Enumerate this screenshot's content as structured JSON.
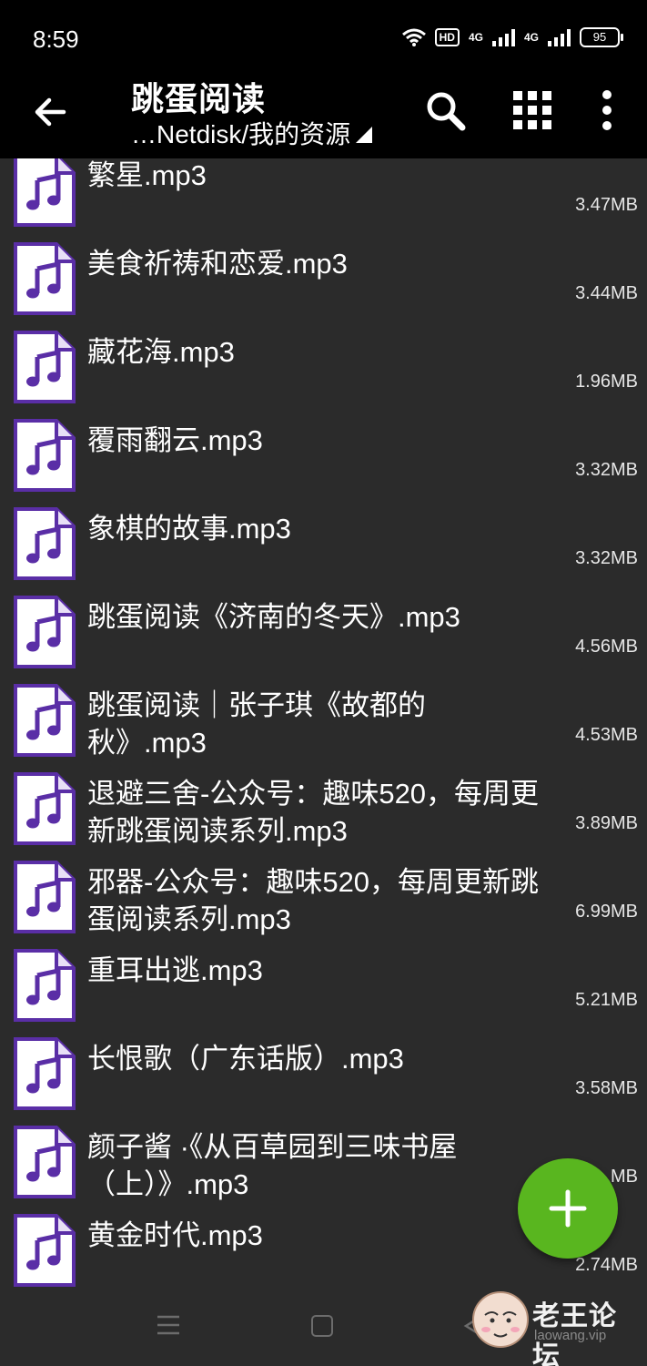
{
  "status_bar": {
    "time": "8:59",
    "hd_label": "HD",
    "network_1": "4G",
    "network_2": "4G",
    "battery": "95"
  },
  "app_bar": {
    "title": "跳蛋阅读",
    "path": "…Netdisk/我的资源",
    "icons": [
      "back-arrow-icon",
      "search-icon",
      "grid-view-icon",
      "more-vert-icon"
    ]
  },
  "files": [
    {
      "name": "繁星.mp3",
      "size": "3.47MB"
    },
    {
      "name": "美食祈祷和恋爱.mp3",
      "size": "3.44MB"
    },
    {
      "name": "藏花海.mp3",
      "size": "1.96MB"
    },
    {
      "name": "覆雨翻云.mp3",
      "size": "3.32MB"
    },
    {
      "name": "象棋的故事.mp3",
      "size": "3.32MB"
    },
    {
      "name": "跳蛋阅读《济南的冬天》.mp3",
      "size": "4.56MB"
    },
    {
      "name": "跳蛋阅读｜张子琪《故都的秋》.mp3",
      "size": "4.53MB"
    },
    {
      "name": "退避三舍-公众号：趣味520，每周更新跳蛋阅读系列.mp3",
      "size": "3.89MB"
    },
    {
      "name": "邪器-公众号：趣味520，每周更新跳蛋阅读系列.mp3",
      "size": "6.99MB"
    },
    {
      "name": "重耳出逃.mp3",
      "size": "5.21MB"
    },
    {
      "name": "长恨歌（广东话版）.mp3",
      "size": "3.58MB"
    },
    {
      "name": "颜子酱 ·《从百草园到三味书屋（上）》.mp3",
      "size": "MB"
    },
    {
      "name": "黄金时代.mp3",
      "size": "2.74MB"
    }
  ],
  "fab": {
    "icon": "add-icon",
    "color": "#59b61f"
  },
  "watermark": {
    "title": "老王论坛",
    "sub": "laowang.vip"
  },
  "colors": {
    "background": "#2b2b2b",
    "bar": "#000000",
    "icon_purple": "#5a2ea6",
    "fab_green": "#59b61f"
  }
}
